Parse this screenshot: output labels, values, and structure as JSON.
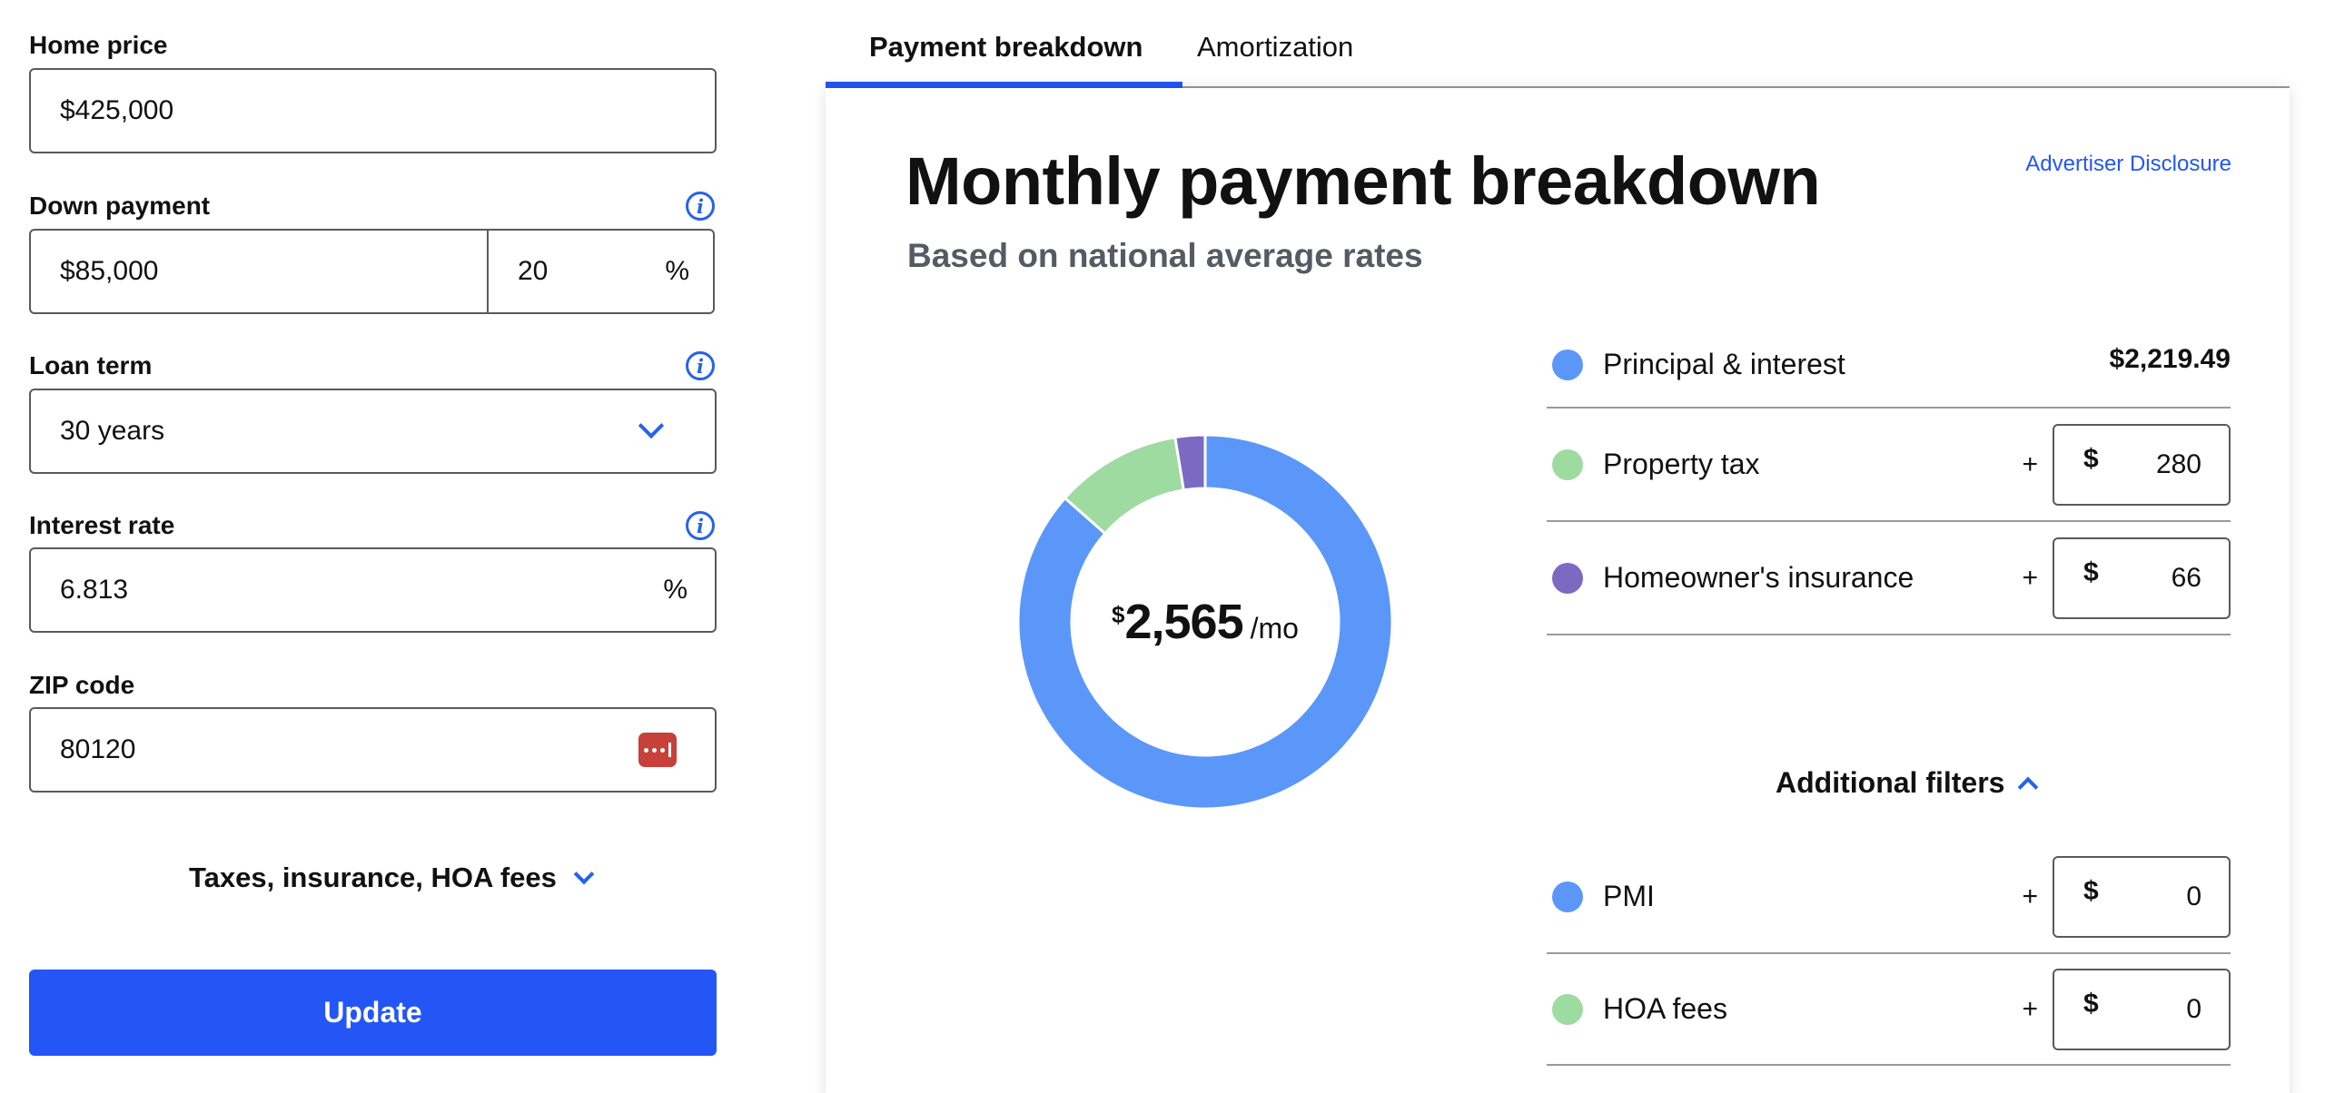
{
  "form": {
    "home_price": {
      "label": "Home price",
      "value": "$425,000"
    },
    "down_payment": {
      "label": "Down payment",
      "value": "$85,000",
      "percent": "20",
      "percent_suffix": "%"
    },
    "loan_term": {
      "label": "Loan term",
      "value": "30 years"
    },
    "interest_rate": {
      "label": "Interest rate",
      "value": "6.813",
      "suffix": "%"
    },
    "zip_code": {
      "label": "ZIP code",
      "value": "80120"
    },
    "toggle_label": "Taxes, insurance, HOA fees",
    "update_label": "Update"
  },
  "tabs": [
    {
      "label": "Payment breakdown",
      "active": true
    },
    {
      "label": "Amortization",
      "active": false
    }
  ],
  "card": {
    "title": "Monthly payment breakdown",
    "subtitle": "Based on national average rates",
    "disclosure": "Advertiser Disclosure",
    "total": {
      "currency": "$",
      "amount": "2,565",
      "period": "/mo"
    },
    "items": [
      {
        "label": "Principal & interest",
        "amount": "$2,219.49",
        "color": "#5b97f8"
      },
      {
        "label": "Property tax",
        "plus": "+",
        "currency": "$",
        "value": "280",
        "color": "#9edba0"
      },
      {
        "label": "Homeowner's insurance",
        "plus": "+",
        "currency": "$",
        "value": "66",
        "color": "#7b6ac2"
      }
    ],
    "additional_filters": "Additional filters",
    "extra_items": [
      {
        "label": "PMI",
        "plus": "+",
        "currency": "$",
        "value": "0",
        "color": "#5b97f8"
      },
      {
        "label": "HOA fees",
        "plus": "+",
        "currency": "$",
        "value": "0",
        "color": "#9edba0"
      }
    ]
  },
  "chart_data": {
    "type": "pie",
    "categories": [
      "Principal & interest",
      "Property tax",
      "Homeowner's insurance"
    ],
    "values": [
      2219.49,
      280,
      66
    ],
    "colors": [
      "#5b97f8",
      "#9edba0",
      "#7b6ac2"
    ]
  }
}
